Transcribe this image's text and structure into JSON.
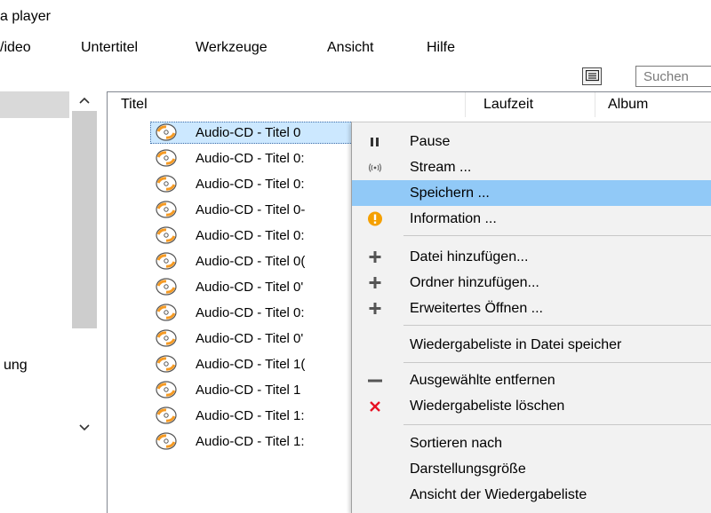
{
  "window": {
    "title": "a player"
  },
  "menu_bar": {
    "items": [
      "/ideo",
      "Untertitel",
      "Werkzeuge",
      "Ansicht",
      "Hilfe"
    ]
  },
  "toolbar": {
    "search_placeholder": "Suchen"
  },
  "left_panel": {
    "partial_label": "ung"
  },
  "playlist": {
    "columns": [
      "Titel",
      "Laufzeit",
      "Album"
    ],
    "rows": [
      "Audio-CD - Titel 0",
      "Audio-CD - Titel 0:",
      "Audio-CD - Titel 0:",
      "Audio-CD - Titel 0‐",
      "Audio-CD - Titel 0:",
      "Audio-CD - Titel 0(",
      "Audio-CD - Titel 0'",
      "Audio-CD - Titel 0:",
      "Audio-CD - Titel 0'",
      "Audio-CD - Titel 1(",
      "Audio-CD - Titel 1",
      "Audio-CD - Titel 1:",
      "Audio-CD - Titel 1:"
    ],
    "selected_row": 0
  },
  "context_menu": {
    "items": [
      {
        "label": "Pause",
        "icon": "pause-icon"
      },
      {
        "label": "Stream ...",
        "icon": "stream-icon"
      },
      {
        "label": "Speichern ...",
        "icon": "",
        "highlighted": true
      },
      {
        "label": "Information ...",
        "icon": "info-icon"
      },
      {
        "label": "Datei hinzufügen...",
        "icon": "plus-icon"
      },
      {
        "label": "Ordner hinzufügen...",
        "icon": "plus-icon"
      },
      {
        "label": "Erweitertes Öffnen ...",
        "icon": "plus-icon"
      },
      {
        "label": "Wiedergabeliste in Datei speicher",
        "icon": ""
      },
      {
        "label": "Ausgewählte entfernen",
        "icon": "minus-icon"
      },
      {
        "label": "Wiedergabeliste löschen",
        "icon": "close-icon"
      },
      {
        "label": "Sortieren nach",
        "icon": ""
      },
      {
        "label": "Darstellungsgröße",
        "icon": ""
      },
      {
        "label": "Ansicht der Wiedergabeliste",
        "icon": ""
      }
    ]
  },
  "colors": {
    "highlight": "#91c9f7",
    "info_orange": "#f5a000",
    "delete_red": "#e81123",
    "disc_orange": "#f59a23",
    "selection": "#cce8ff"
  }
}
